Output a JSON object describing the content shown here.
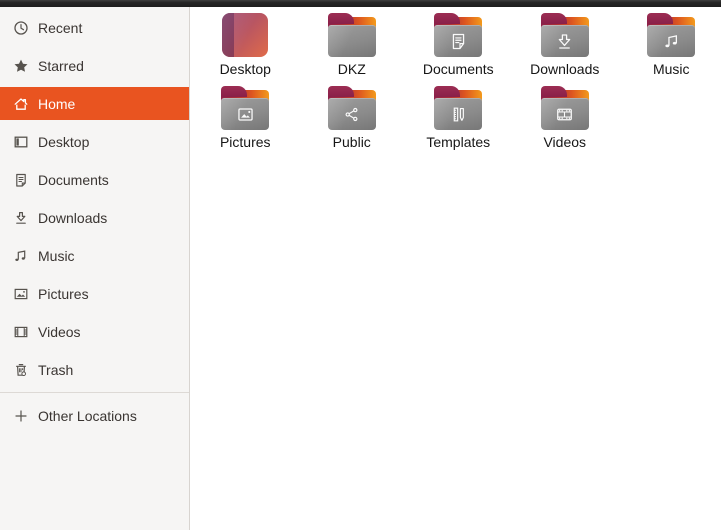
{
  "sidebar": {
    "items": [
      {
        "label": "Recent",
        "icon": "clock-icon",
        "active": false
      },
      {
        "label": "Starred",
        "icon": "star-icon",
        "active": false
      },
      {
        "label": "Home",
        "icon": "home-icon",
        "active": true
      },
      {
        "label": "Desktop",
        "icon": "window-icon",
        "active": false
      },
      {
        "label": "Documents",
        "icon": "document-icon",
        "active": false
      },
      {
        "label": "Downloads",
        "icon": "download-arrow-icon",
        "active": false
      },
      {
        "label": "Music",
        "icon": "music-note-icon",
        "active": false
      },
      {
        "label": "Pictures",
        "icon": "picture-icon",
        "active": false
      },
      {
        "label": "Videos",
        "icon": "film-icon",
        "active": false
      },
      {
        "label": "Trash",
        "icon": "trash-icon",
        "active": false
      }
    ],
    "footer_item": {
      "label": "Other Locations",
      "icon": "plus-icon"
    }
  },
  "files": {
    "rows": [
      [
        {
          "name": "Desktop",
          "icon": "desktop-gradient-icon",
          "emblem": null
        },
        {
          "name": "DKZ",
          "icon": "folder-icon",
          "emblem": null
        },
        {
          "name": "Documents",
          "icon": "folder-icon",
          "emblem": "document-emblem-icon"
        },
        {
          "name": "Downloads",
          "icon": "folder-icon",
          "emblem": "download-arrow-emblem-icon"
        },
        {
          "name": "Music",
          "icon": "folder-icon",
          "emblem": "music-note-emblem-icon"
        }
      ],
      [
        {
          "name": "Pictures",
          "icon": "folder-icon",
          "emblem": "image-emblem-icon"
        },
        {
          "name": "Public",
          "icon": "folder-icon",
          "emblem": "share-emblem-icon"
        },
        {
          "name": "Templates",
          "icon": "folder-icon",
          "emblem": "template-emblem-icon"
        },
        {
          "name": "Videos",
          "icon": "folder-icon",
          "emblem": "film-emblem-icon"
        }
      ]
    ]
  },
  "colors": {
    "accent": "#e95420",
    "sidebar_bg": "#f6f5f4",
    "content_bg": "#ffffff",
    "top_strip": "#262626",
    "folder_body": "#8b8b8b",
    "folder_tab": "#8e2149",
    "folder_orange": "#f39a1b"
  }
}
